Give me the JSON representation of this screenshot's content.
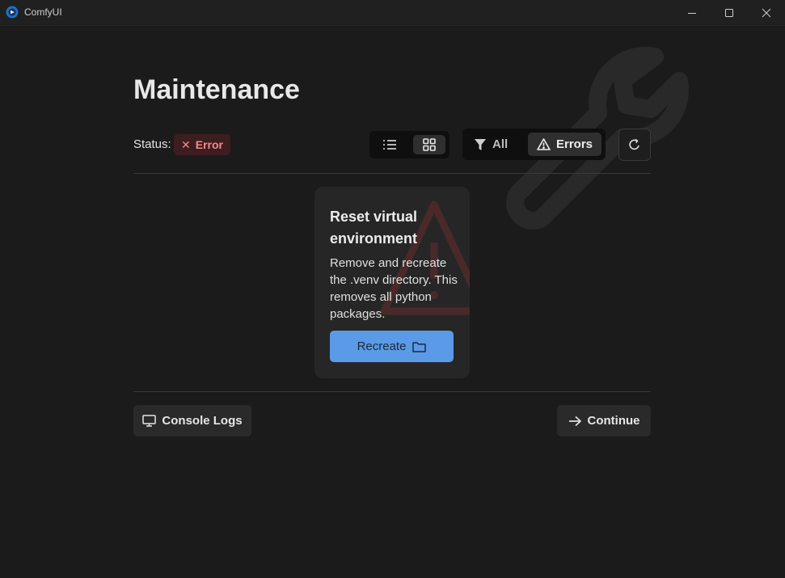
{
  "window": {
    "title": "ComfyUI",
    "minimize_icon": "minimize-icon",
    "maximize_icon": "maximize-icon",
    "close_icon": "close-icon"
  },
  "page": {
    "title": "Maintenance"
  },
  "status": {
    "label": "Status:",
    "badge_text": "Error",
    "badge_icon": "x-icon",
    "badge_color": "#f08c8c"
  },
  "view_toggle": {
    "list_icon": "list-icon",
    "grid_icon": "grid-icon",
    "selected": "grid"
  },
  "filter": {
    "all_label": "All",
    "errors_label": "Errors",
    "selected": "Errors"
  },
  "refresh_icon": "refresh-icon",
  "tasks": [
    {
      "title": "Reset virtual environment",
      "description": "Remove and recreate the .venv directory. This removes all python packages.",
      "button_label": "Recreate",
      "button_icon": "folder-icon",
      "status": "error"
    }
  ],
  "footer": {
    "console_label": "Console Logs",
    "continue_label": "Continue"
  },
  "colors": {
    "accent": "#5a9ae6",
    "error": "#f08c8c",
    "background": "#1b1b1b"
  }
}
